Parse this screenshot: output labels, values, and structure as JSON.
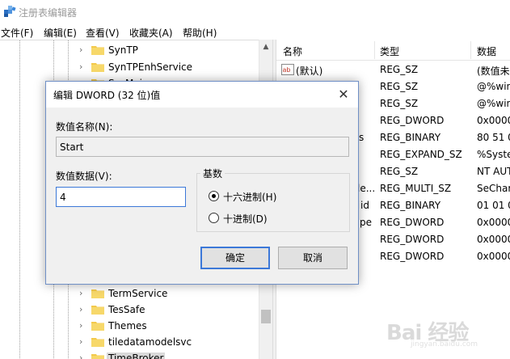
{
  "window": {
    "title": "注册表编辑器"
  },
  "menu": [
    "文件(F)",
    "编辑(E)",
    "查看(V)",
    "收藏夹(A)",
    "帮助(H)"
  ],
  "tree": {
    "items": [
      {
        "label": "SynTP",
        "selected": false
      },
      {
        "label": "SynTPEnhService",
        "selected": false
      },
      {
        "label": "SysMain",
        "selected": false
      },
      {
        "label": "TermService",
        "selected": false
      },
      {
        "label": "TesSafe",
        "selected": false
      },
      {
        "label": "Themes",
        "selected": false
      },
      {
        "label": "tiledatamodelsvc",
        "selected": false
      },
      {
        "label": "TimeBroker",
        "selected": true
      }
    ]
  },
  "list": {
    "columns": [
      "名称",
      "类型",
      "数据"
    ],
    "rows": [
      {
        "name": "(默认)",
        "type": "REG_SZ",
        "data": "(数值未"
      },
      {
        "name": "",
        "type": "REG_SZ",
        "data": "@%win"
      },
      {
        "name": "",
        "type": "REG_SZ",
        "data": "@%win"
      },
      {
        "name": "",
        "type": "REG_DWORD",
        "data": "0x0000"
      },
      {
        "name": "s",
        "type": "REG_BINARY",
        "data": "80 51 0"
      },
      {
        "name": "",
        "type": "REG_EXPAND_SZ",
        "data": "%Syste"
      },
      {
        "name": "",
        "type": "REG_SZ",
        "data": "NT AUT"
      },
      {
        "name": "le...",
        "type": "REG_MULTI_SZ",
        "data": "SeChar"
      },
      {
        "name": "id",
        "type": "REG_BINARY",
        "data": "01 01 0"
      },
      {
        "name": "pe",
        "type": "REG_DWORD",
        "data": "0x0000"
      },
      {
        "name": "",
        "type": "REG_DWORD",
        "data": "0x0000"
      },
      {
        "name": "",
        "type": "REG_DWORD",
        "data": "0x0000"
      }
    ]
  },
  "dialog": {
    "title": "编辑 DWORD (32 位)值",
    "close_glyph": "✕",
    "value_name_label": "数值名称(N):",
    "value_name": "Start",
    "value_data_label": "数值数据(V):",
    "value_data": "4",
    "base_label": "基数",
    "radios": [
      {
        "label": "十六进制(H)",
        "checked": true
      },
      {
        "label": "十进制(D)",
        "checked": false
      }
    ],
    "ok_label": "确定",
    "cancel_label": "取消"
  },
  "watermark": {
    "text": "Bai 经验",
    "sub": "jingyan.baidu.com"
  },
  "colors": {
    "accent": "#3c78d8",
    "folder": "#f3c94b",
    "dialog_bg": "#f0f0f0"
  }
}
